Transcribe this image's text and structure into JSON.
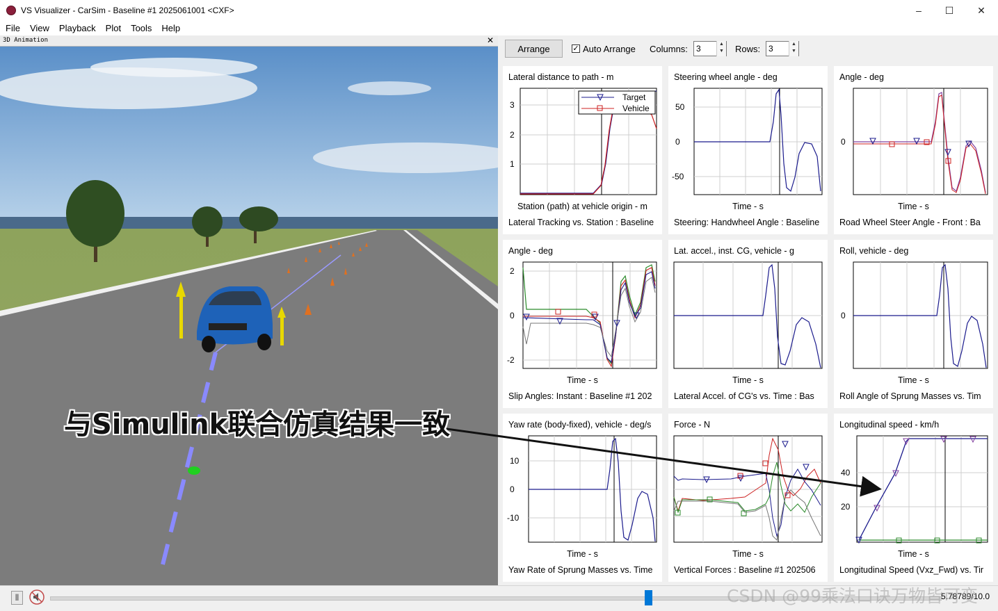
{
  "window": {
    "title": "VS Visualizer - CarSim - Baseline #1 2025061001 <CXF>",
    "minimize": "–",
    "maximize": "☐",
    "close": "✕"
  },
  "menu": [
    "File",
    "View",
    "Playback",
    "Plot",
    "Tools",
    "Help"
  ],
  "animation_panel": {
    "title": "3D Animation",
    "close": "✕"
  },
  "toolbar": {
    "arrange": "Arrange",
    "auto_arrange": "Auto Arrange",
    "auto_arrange_checked": true,
    "columns_label": "Columns:",
    "columns_value": "3",
    "rows_label": "Rows:",
    "rows_value": "3"
  },
  "plots": [
    {
      "title": "Lateral distance to path - m",
      "xlabel": "Station (path) at vehicle origin - m",
      "caption": "Lateral Tracking vs. Station : Baseline",
      "yticks": [
        "3",
        "2",
        "1"
      ],
      "legend": [
        "Target",
        "Vehicle"
      ]
    },
    {
      "title": "Steering wheel angle - deg",
      "xlabel": "Time - s",
      "caption": "Steering: Handwheel Angle : Baseline",
      "yticks": [
        "50",
        "0",
        "-50"
      ]
    },
    {
      "title": "Angle - deg",
      "xlabel": "Time - s",
      "caption": "Road Wheel Steer Angle - Front : Ba",
      "yticks": [
        "0"
      ]
    },
    {
      "title": "Angle - deg",
      "xlabel": "Time - s",
      "caption": "Slip Angles: Instant : Baseline #1 202",
      "yticks": [
        "2",
        "0",
        "-2"
      ]
    },
    {
      "title": "Lat. accel., inst. CG, vehicle - g",
      "xlabel": "Time - s",
      "caption": "Lateral Accel. of CG's vs. Time : Bas",
      "yticks": []
    },
    {
      "title": "Roll, vehicle - deg",
      "xlabel": "Time - s",
      "caption": "Roll Angle of Sprung Masses vs. Tim",
      "yticks": [
        "0"
      ]
    },
    {
      "title": "Yaw rate (body-fixed), vehicle - deg/s",
      "xlabel": "Time - s",
      "caption": "Yaw Rate of Sprung Masses vs. Time",
      "yticks": [
        "10",
        "0",
        "-10"
      ]
    },
    {
      "title": "Force - N",
      "xlabel": "Time - s",
      "caption": "Vertical Forces : Baseline #1 202506",
      "yticks": []
    },
    {
      "title": "Longitudinal speed - km/h",
      "xlabel": "Time - s",
      "caption": "Longitudinal Speed (Vxz_Fwd) vs. Tir",
      "yticks": [
        "40",
        "20"
      ]
    }
  ],
  "annotation": "与Simulink联合仿真结果一致",
  "playback": {
    "pause": "||",
    "time": "5.78789/10.0",
    "progress": 0.5787
  },
  "watermark": "CSDN @99乘法口诀万物皆可变",
  "colors": {
    "accent": "#0078d7",
    "series_blue": "#1a1a8c",
    "series_red": "#cc2020",
    "series_green": "#2a8a2a",
    "series_gray": "#777777",
    "series_purple": "#8040a0"
  }
}
